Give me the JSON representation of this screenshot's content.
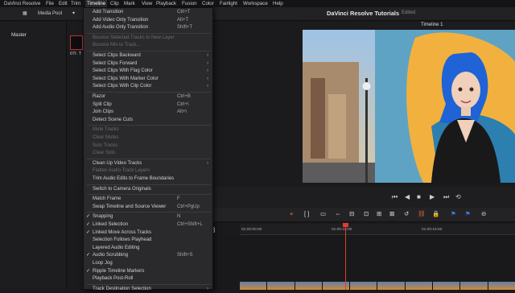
{
  "menubar": {
    "items": [
      "DaVinci Resolve",
      "File",
      "Edit",
      "Trim",
      "Timeline",
      "Clip",
      "Mark",
      "View",
      "Playback",
      "Fusion",
      "Color",
      "Fairlight",
      "Workspace",
      "Help"
    ]
  },
  "header": {
    "title": "DaVinci Resolve Tutorials",
    "status": "Edited",
    "media_pool": "Media Pool",
    "timeline_name": "Timeline 1"
  },
  "sidebar": {
    "master": "Master"
  },
  "clip": {
    "label": "07I. T"
  },
  "timeline": {
    "big_tc": "3",
    "ruler": [
      "01:00:00:00",
      "01:00:10:00",
      "01:00:15:00"
    ]
  },
  "timeline_menu": [
    {
      "label": "Add Transition",
      "shortcut": "Ctrl+T"
    },
    {
      "label": "Add Video Only Transition",
      "shortcut": "Alt+T"
    },
    {
      "label": "Add Audio Only Transition",
      "shortcut": "Shift+T"
    },
    {
      "sep": true
    },
    {
      "label": "Bounce Selected Tracks to New Layer",
      "disabled": true
    },
    {
      "label": "Bounce Mix to Track...",
      "disabled": true
    },
    {
      "sep": true
    },
    {
      "label": "Select Clips Backward",
      "submenu": true
    },
    {
      "label": "Select Clips Forward",
      "submenu": true
    },
    {
      "label": "Select Clips With Flag Color",
      "submenu": true
    },
    {
      "label": "Select Clips With Marker Color",
      "submenu": true
    },
    {
      "label": "Select Clips With Clip Color",
      "submenu": true
    },
    {
      "sep": true
    },
    {
      "label": "Razor",
      "shortcut": "Ctrl+B"
    },
    {
      "label": "Split Clip",
      "shortcut": "Ctrl+\\"
    },
    {
      "label": "Join Clips",
      "shortcut": "Alt+\\"
    },
    {
      "label": "Detect Scene Cuts"
    },
    {
      "sep": true
    },
    {
      "label": "Mute Tracks",
      "disabled": true
    },
    {
      "label": "Clear Mutes",
      "disabled": true
    },
    {
      "label": "Solo Tracks",
      "disabled": true
    },
    {
      "label": "Clear Solo",
      "disabled": true
    },
    {
      "sep": true
    },
    {
      "label": "Clean Up Video Tracks",
      "submenu": true
    },
    {
      "label": "Flatten Audio Track Layers",
      "disabled": true
    },
    {
      "label": "Trim Audio Edits to Frame Boundaries"
    },
    {
      "sep": true
    },
    {
      "label": "Switch to Camera Originals"
    },
    {
      "sep": true
    },
    {
      "label": "Match Frame",
      "shortcut": "F"
    },
    {
      "label": "Swap Timeline and Source Viewer",
      "shortcut": "Ctrl+PgUp"
    },
    {
      "sep": true
    },
    {
      "label": "Snapping",
      "shortcut": "N",
      "checked": true
    },
    {
      "label": "Linked Selection",
      "shortcut": "Ctrl+Shift+L",
      "checked": true
    },
    {
      "label": "Linked Move Across Tracks",
      "checked": true
    },
    {
      "label": "Selection Follows Playhead"
    },
    {
      "label": "Layered Audio Editing"
    },
    {
      "label": "Audio Scrubbing",
      "shortcut": "Shift+S",
      "checked": true
    },
    {
      "label": "Loop Jog"
    },
    {
      "label": "Ripple Timeline Markers",
      "checked": true
    },
    {
      "label": "Playback Post-Roll"
    },
    {
      "sep": true
    },
    {
      "label": "Track Destination Selection",
      "submenu": true
    }
  ],
  "transport": [
    "⏮",
    "◀",
    "■",
    "▶",
    "⏭",
    "⟲"
  ],
  "tools": [
    "⌖",
    "[ ]",
    "▭",
    "⇔",
    "⊟",
    "⊡",
    "⊞",
    "⊠",
    "↺",
    "⛓",
    "🔒",
    "⚑",
    "⚑",
    "⊖"
  ]
}
